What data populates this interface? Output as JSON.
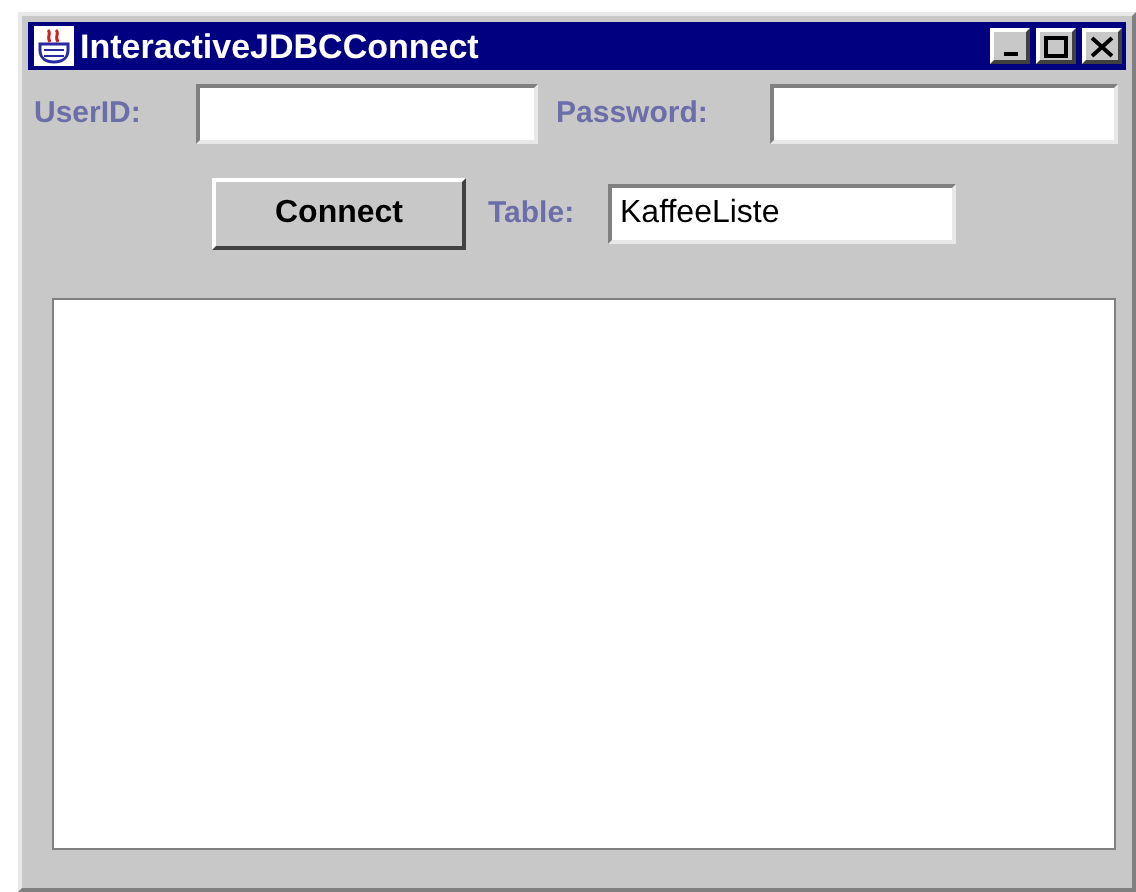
{
  "window": {
    "title": "InteractiveJDBCConnect"
  },
  "userid": {
    "label": "UserID:"
  },
  "password": {
    "label": "Password:"
  },
  "connect_button": "Connect",
  "table": {
    "label": "Table:",
    "value": "KaffeeListe"
  }
}
